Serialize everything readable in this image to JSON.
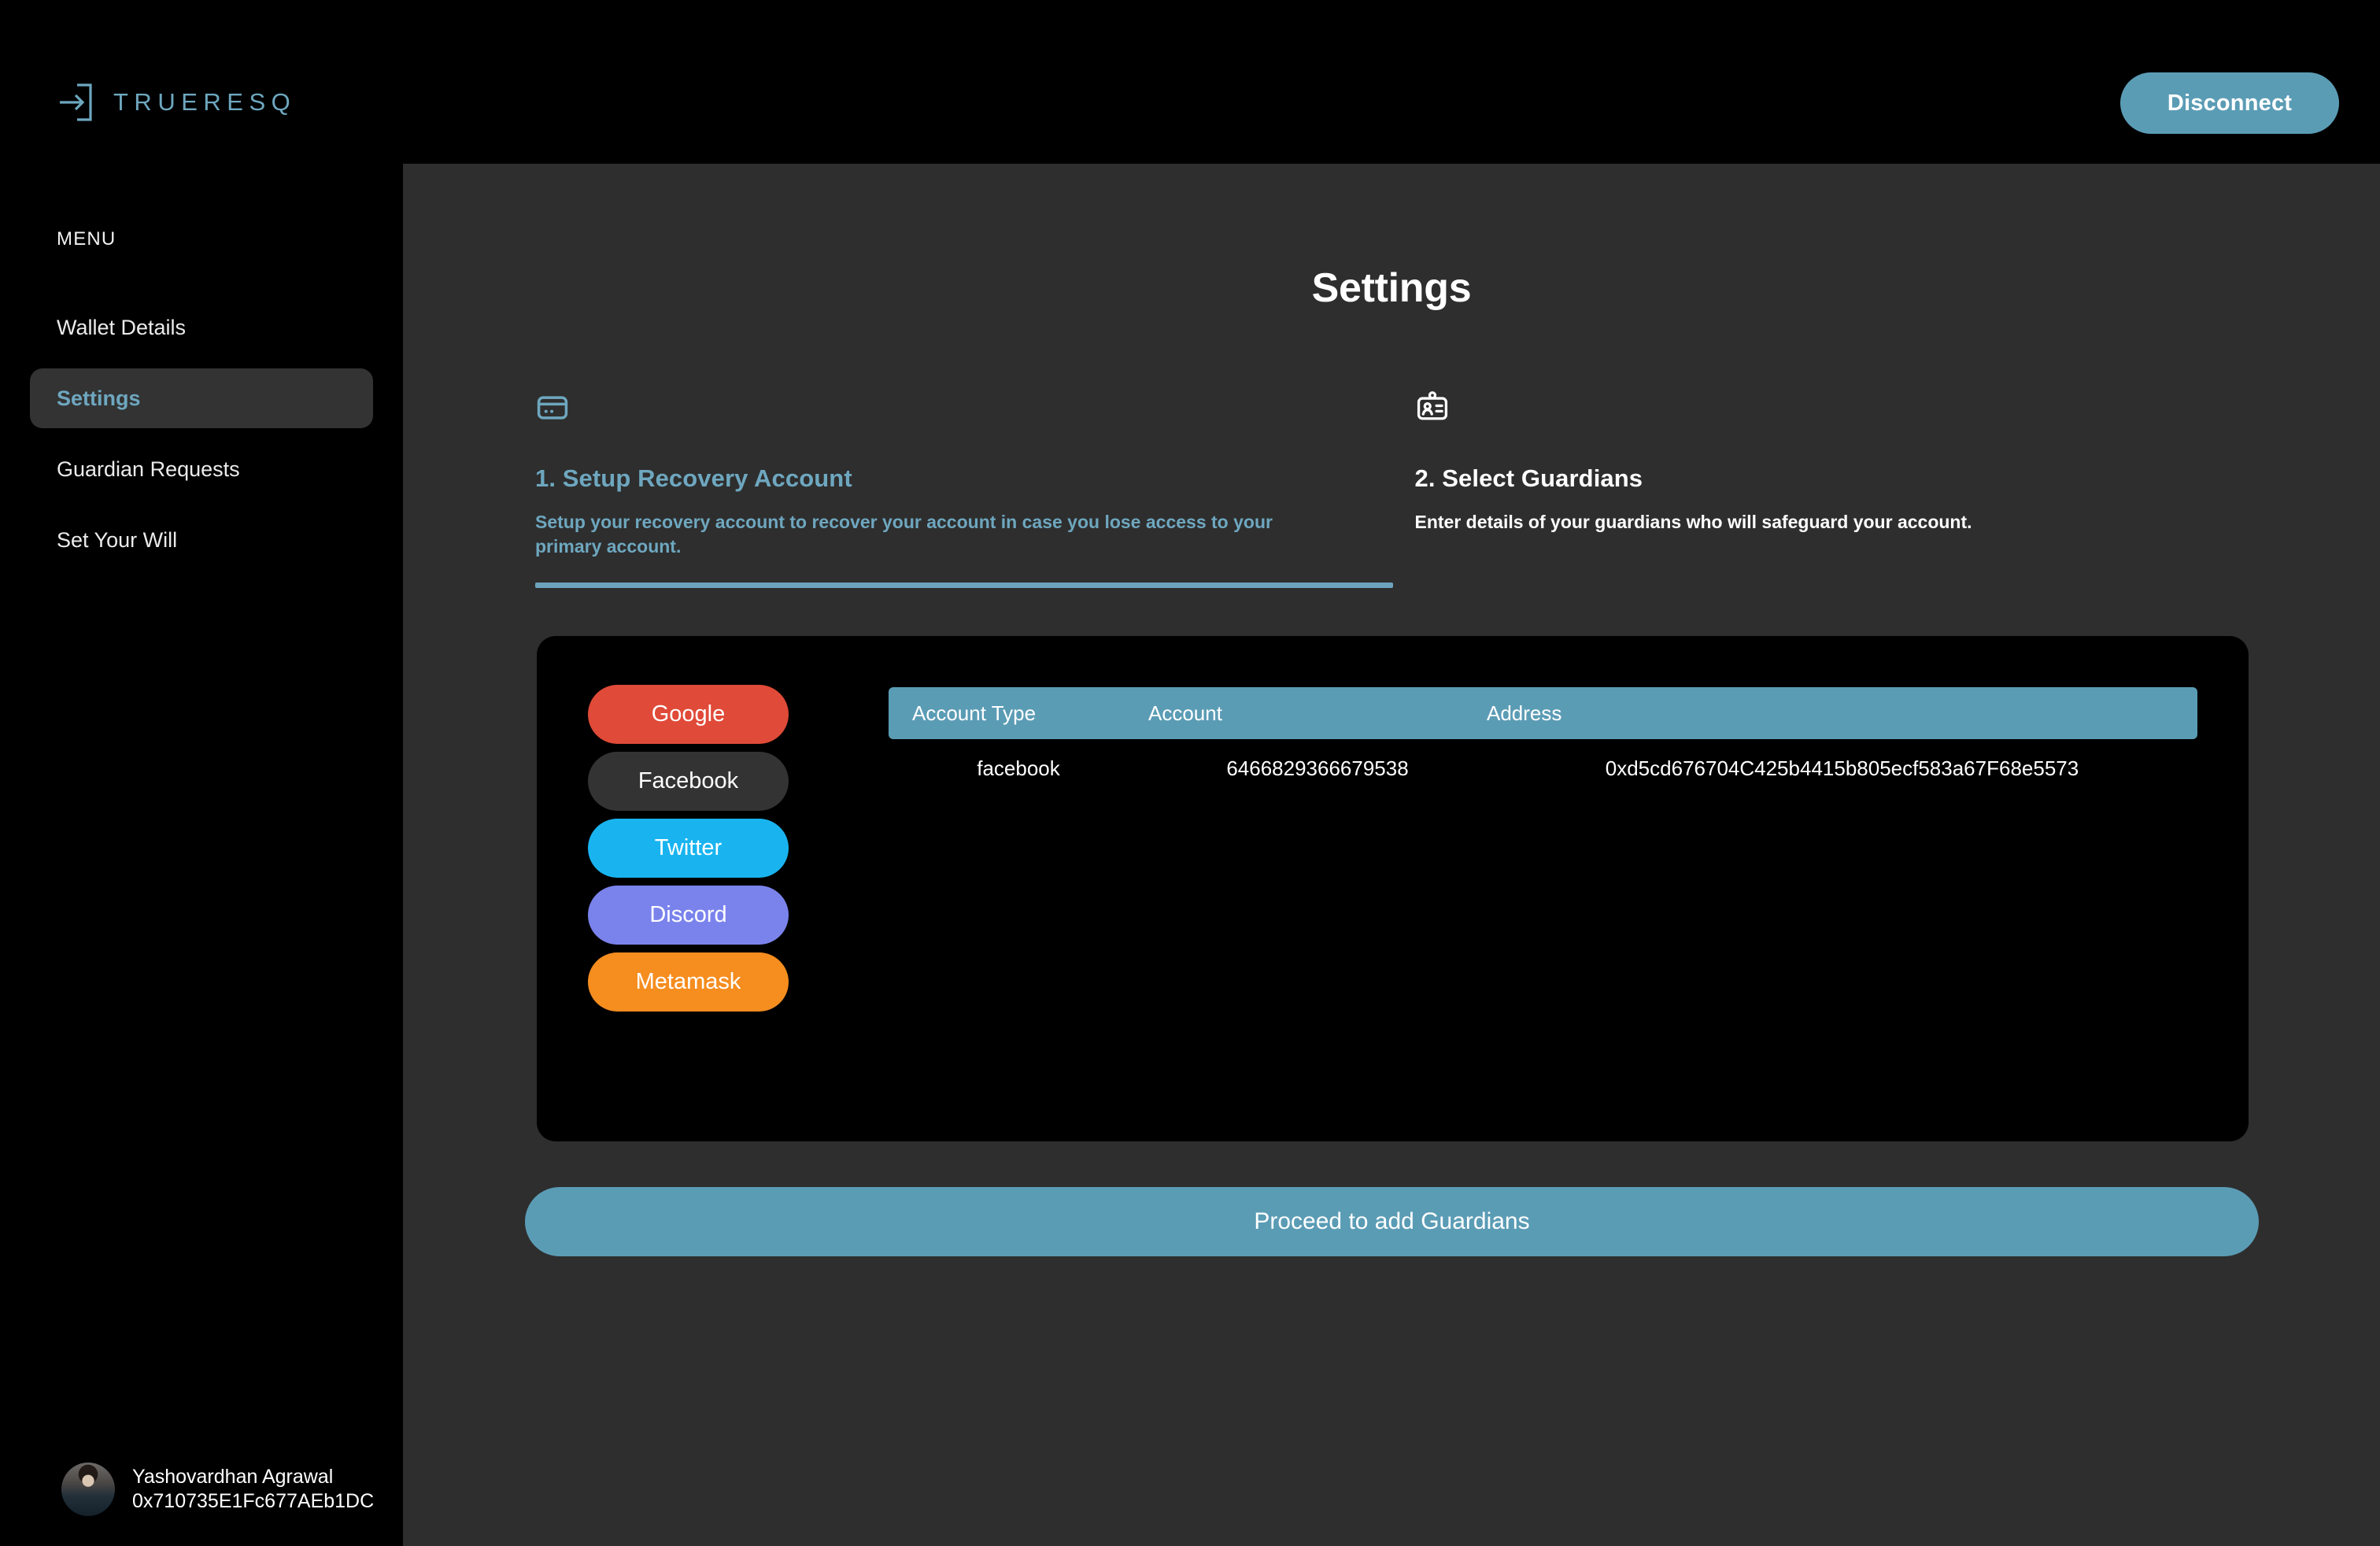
{
  "brand": {
    "name": "TRUERESQ",
    "logo_icon": "arrow-into-bracket-icon",
    "color": "#6ea7bf"
  },
  "topbar": {
    "disconnect_label": "Disconnect",
    "disconnect_color": "#5b9cb5"
  },
  "sidebar": {
    "heading": "MENU",
    "items": [
      {
        "label": "Wallet Details",
        "active": false
      },
      {
        "label": "Settings",
        "active": true
      },
      {
        "label": "Guardian Requests",
        "active": false
      },
      {
        "label": "Set Your Will",
        "active": false
      }
    ],
    "profile": {
      "name": "Yashovardhan Agrawal",
      "address": "0x710735E1Fc677AEb1DC",
      "avatar_icon": "user-avatar"
    }
  },
  "main": {
    "title": "Settings",
    "steps": [
      {
        "icon": "credit-card-icon",
        "title": "1. Setup Recovery Account",
        "description": "Setup your recovery account to recover your account in case you lose access to your primary account.",
        "active": true
      },
      {
        "icon": "id-badge-icon",
        "title": "2. Select Guardians",
        "description": "Enter details of your guardians who will safeguard your account.",
        "active": false
      }
    ],
    "socials": [
      {
        "label": "Google",
        "color": "#e04a38"
      },
      {
        "label": "Facebook",
        "color": "#333333"
      },
      {
        "label": "Twitter",
        "color": "#19b4f0"
      },
      {
        "label": "Discord",
        "color": "#7a83ec"
      },
      {
        "label": "Metamask",
        "color": "#f58d1f"
      }
    ],
    "table": {
      "header_color": "#5b9cb5",
      "columns": [
        "Account Type",
        "Account",
        "Address"
      ],
      "rows": [
        {
          "account_type": "facebook",
          "account": "6466829366679538",
          "address": "0xd5cd676704C425b4415b805ecf583a67F68e5573"
        }
      ]
    },
    "proceed_label": "Proceed to add Guardians"
  }
}
